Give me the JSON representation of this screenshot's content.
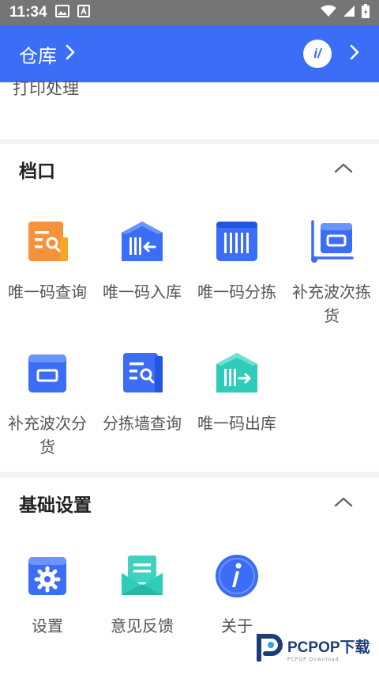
{
  "statusbar": {
    "time": "11:34"
  },
  "header": {
    "title": "仓库",
    "logo_text": "i/"
  },
  "top_section": {
    "partial_label": "打印处理"
  },
  "section_dangkou": {
    "title": "档口",
    "items": [
      {
        "label": "唯一码查询",
        "icon": "search-document-icon"
      },
      {
        "label": "唯一码入库",
        "icon": "warehouse-inbound-icon"
      },
      {
        "label": "唯一码分拣",
        "icon": "barcode-sort-icon"
      },
      {
        "label": "补充波次拣货",
        "icon": "cart-box-icon"
      },
      {
        "label": "补充波次分货",
        "icon": "box-icon"
      },
      {
        "label": "分拣墙查询",
        "icon": "wall-search-icon"
      },
      {
        "label": "唯一码出库",
        "icon": "warehouse-outbound-icon"
      }
    ]
  },
  "section_basic": {
    "title": "基础设置",
    "items": [
      {
        "label": "设置",
        "icon": "gear-icon"
      },
      {
        "label": "意见反馈",
        "icon": "feedback-icon"
      },
      {
        "label": "关于",
        "icon": "info-icon"
      }
    ]
  },
  "watermark": {
    "text": "PCPOP下载",
    "sub": "PCPOP Download"
  },
  "colors": {
    "primary": "#3b6df6",
    "teal": "#2fcdb9",
    "orange": "#f7913c"
  }
}
